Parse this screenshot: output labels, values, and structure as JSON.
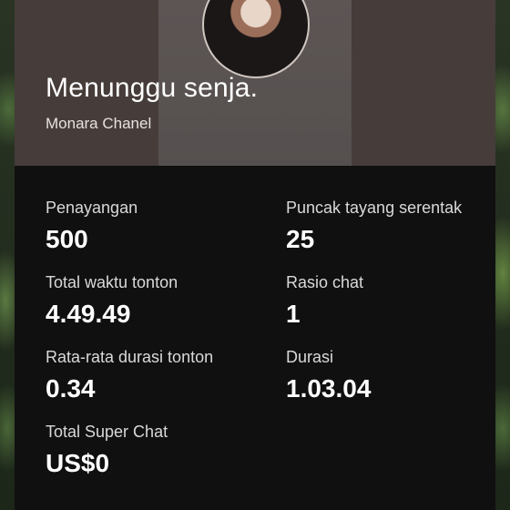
{
  "video": {
    "title": "Menunggu senja.",
    "channel": "Monara Chanel"
  },
  "stats": [
    {
      "label": "Penayangan",
      "value": "500"
    },
    {
      "label": "Puncak tayang serentak",
      "value": "25"
    },
    {
      "label": "Total waktu tonton",
      "value": "4.49.49"
    },
    {
      "label": "Rasio chat",
      "value": "1"
    },
    {
      "label": "Rata-rata durasi tonton",
      "value": "0.34"
    },
    {
      "label": "Durasi",
      "value": "1.03.04"
    },
    {
      "label": "Total Super Chat",
      "value": "US$0"
    }
  ]
}
